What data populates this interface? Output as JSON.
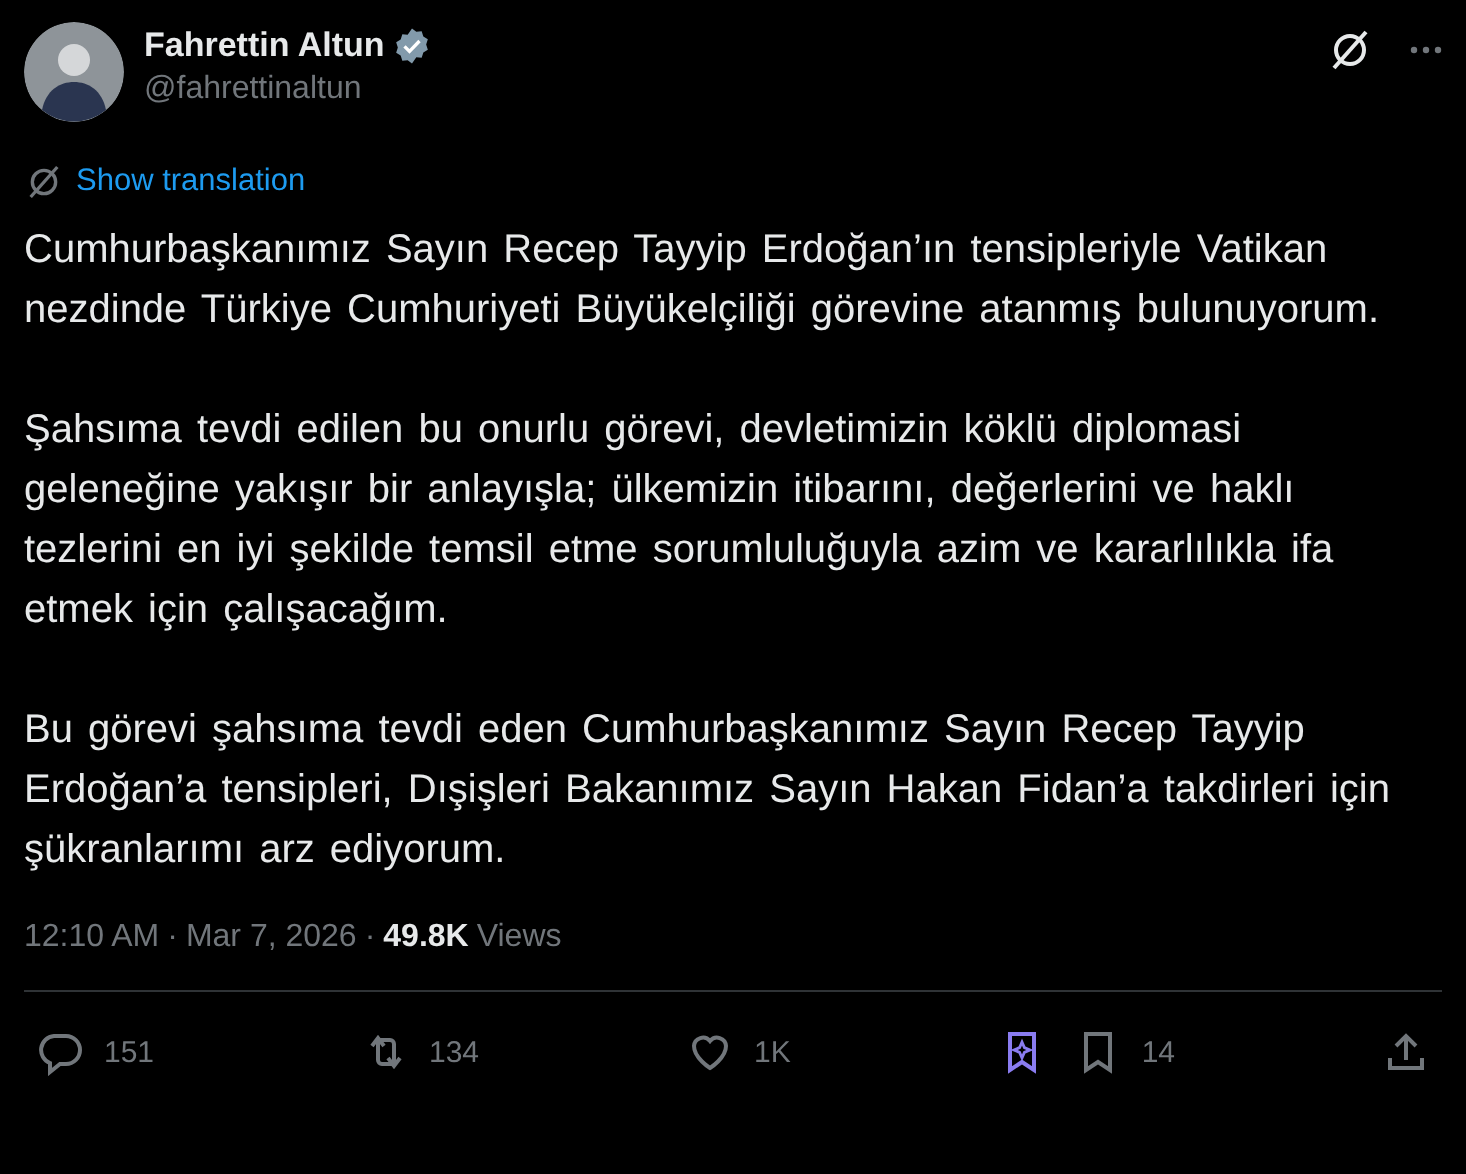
{
  "author": {
    "name": "Fahrettin Altun",
    "handle": "@fahrettinaltun",
    "verified": true
  },
  "translation_link": "Show translation",
  "paragraphs": [
    "Cumhurbaşkanımız Sayın Recep Tayyip Erdoğan’ın tensipleriyle Vatikan nezdinde Türkiye Cumhuriyeti Büyükelçiliği görevine atanmış bulunuyorum.",
    "Şahsıma tevdi edilen bu onurlu görevi, devletimizin köklü diplomasi geleneğine yakışır bir anlayışla; ülkemizin itibarını, değerlerini ve haklı tezlerini en iyi şekilde temsil etme sorumluluğuyla azim ve kararlılıkla ifa etmek için çalışacağım.",
    "Bu görevi şahsıma tevdi eden Cumhurbaşkanımız Sayın Recep Tayyip Erdoğan’a tensipleri, Dışişleri Bakanımız Sayın Hakan Fidan’a takdirleri için şükranlarımı arz ediyorum."
  ],
  "meta": {
    "time": "12:10 AM",
    "separator_1": "·",
    "date": "Mar 7, 2026",
    "separator_2": "·",
    "views_count": "49.8K",
    "views_label": "Views"
  },
  "actions": [
    {
      "kind": "reply",
      "count": "151"
    },
    {
      "kind": "repost",
      "count": "134"
    },
    {
      "kind": "like",
      "count": "1K"
    },
    {
      "kind": "grok"
    },
    {
      "kind": "bookmark",
      "count": "14"
    },
    {
      "kind": "share"
    }
  ]
}
